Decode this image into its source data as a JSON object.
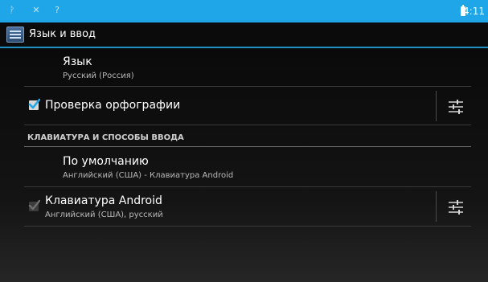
{
  "status_bar": {
    "time": "4:11",
    "icons": [
      "usb-icon",
      "tools-icon",
      "wifi-icon",
      "battery-icon"
    ]
  },
  "action_bar": {
    "title": "Язык и ввод",
    "icon": "settings-language-icon"
  },
  "preferences": {
    "language": {
      "title": "Язык",
      "summary": "Русский (Россия)"
    },
    "spellcheck": {
      "title": "Проверка орфографии",
      "checked": true
    },
    "keyboard_section": {
      "header": "КЛАВИАТУРА И СПОСОБЫ ВВОДА"
    },
    "default_input": {
      "title": "По умолчанию",
      "summary": "Английский (США) - Клавиатура Android"
    },
    "android_keyboard": {
      "title": "Клавиатура Android",
      "summary": "Английский (США), русский",
      "checked": true,
      "enabled": false
    }
  },
  "colors": {
    "status_bar": "#1fa6e8",
    "accent": "#2391c6",
    "checkbox_check": "#1fa6e8"
  }
}
